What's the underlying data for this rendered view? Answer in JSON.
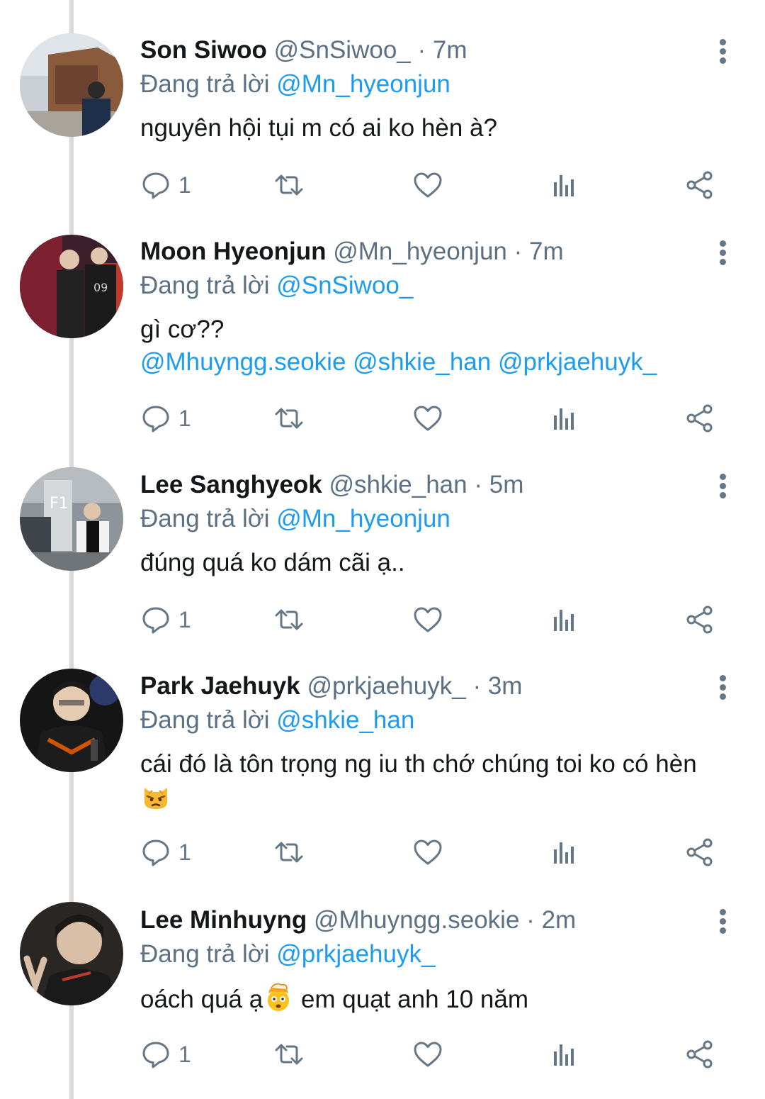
{
  "reply_prefix": "Đang trả lời",
  "tweets": [
    {
      "name": "Son Siwoo",
      "handle": "@SnSiwoo_",
      "dot": "·",
      "time": "7m",
      "reply_to": "@Mn_hyeonjun",
      "text": "nguyên hội tụi m có ai ko hèn à?",
      "reply_count": "1"
    },
    {
      "name": "Moon Hyeonjun",
      "handle": "@Mn_hyeonjun",
      "dot": "·",
      "time": "7m",
      "reply_to": "@SnSiwoo_",
      "text": "gì cơ??",
      "mentions": "@Mhuyngg.seokie @shkie_han @prkjaehuyk_",
      "reply_count": "1"
    },
    {
      "name": "Lee Sanghyeok",
      "handle": "@shkie_han",
      "dot": "·",
      "time": "5m",
      "reply_to": "@Mn_hyeonjun",
      "text": "đúng quá ko dám cãi ạ..",
      "reply_count": "1"
    },
    {
      "name": "Park Jaehuyk",
      "handle": "@prkjaehuyk_",
      "dot": "·",
      "time": "3m",
      "reply_to": "@shkie_han",
      "text": "cái đó là tôn trọng ng iu th chớ chúng toi ko có hèn",
      "emoji": "pouting-cat-emoji",
      "reply_count": "1"
    },
    {
      "name": "Lee Minhuyng",
      "handle": "@Mhuyngg.seokie",
      "dot": "·",
      "time": "2m",
      "reply_to": "@prkjaehuyk_",
      "text_before": "oách quá ạ",
      "emoji": "exploding-head-emoji",
      "text_after": " em quạt anh 10 năm",
      "reply_count": "1"
    }
  ],
  "icons": {
    "reply": "reply-bubble-icon",
    "retweet": "retweet-icon",
    "like": "heart-icon",
    "analytics": "analytics-icon",
    "share": "share-icon",
    "more": "more-vertical-icon"
  },
  "colors": {
    "link": "#1d9bf0",
    "secondary": "#5b7083",
    "text": "#14171a",
    "icon": "#657786",
    "thread_line": "#dadada"
  }
}
